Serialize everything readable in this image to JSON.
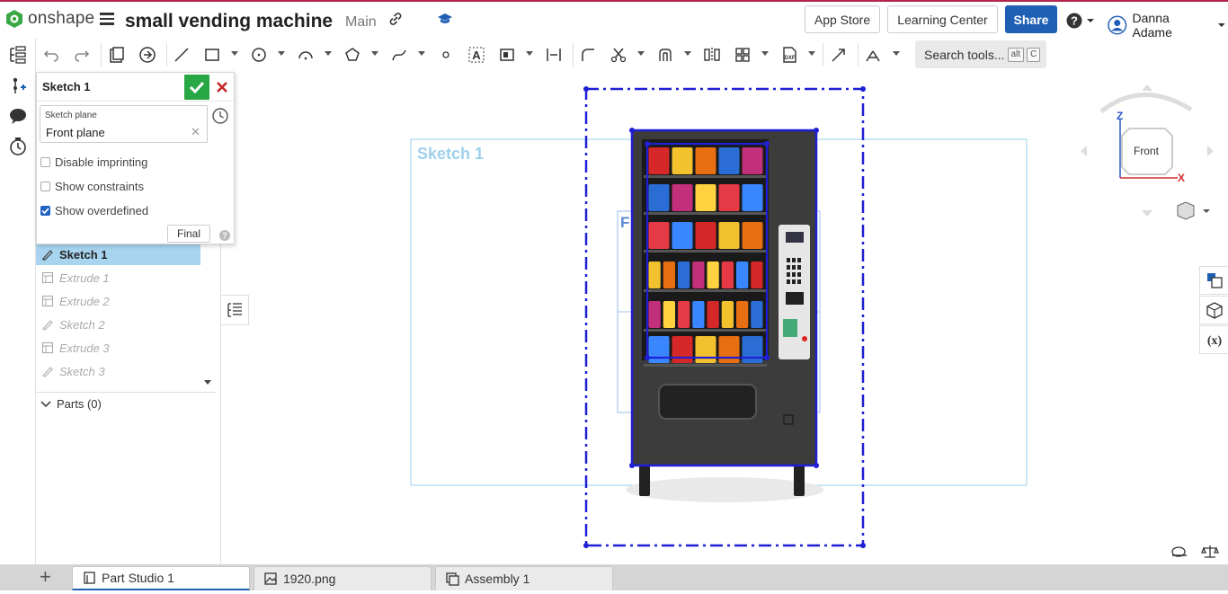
{
  "app": {
    "name": "onshape",
    "document_title": "small vending machine",
    "branch": "Main",
    "brand_color": "#b3254d",
    "accent_color": "#1f5fb4"
  },
  "header": {
    "app_store": "App Store",
    "learning_center": "Learning Center",
    "share": "Share",
    "help_icon": "question-circle-icon",
    "user_name": "Danna Adame"
  },
  "toolbar": {
    "search_label": "Search tools...",
    "search_key1": "alt",
    "search_key2": "C",
    "icons": [
      "undo-icon",
      "redo-icon",
      "new-sketch-icon",
      "extrude-icon",
      "line-icon",
      "rectangle-icon",
      "circle-icon",
      "arc-icon",
      "polygon-icon",
      "spline-icon",
      "point-icon",
      "text-icon",
      "construction-icon",
      "dimension-icon",
      "fillet-icon",
      "trim-icon",
      "offset-icon",
      "mirror-icon",
      "pattern-icon",
      "dxf-icon",
      "use-icon",
      "constraint-icon"
    ]
  },
  "sketch_dialog": {
    "title": "Sketch 1",
    "plane_label": "Sketch plane",
    "plane_value": "Front plane",
    "options": [
      {
        "label": "Disable imprinting",
        "checked": false
      },
      {
        "label": "Show constraints",
        "checked": false
      },
      {
        "label": "Show overdefined",
        "checked": true
      }
    ],
    "final_label": "Final"
  },
  "feature_list": {
    "items": [
      {
        "label": "Sketch 1",
        "selected": true,
        "icon": "sketch-icon"
      },
      {
        "label": "Extrude 1",
        "selected": false,
        "icon": "extrude-icon"
      },
      {
        "label": "Extrude 2",
        "selected": false,
        "icon": "extrude-icon"
      },
      {
        "label": "Sketch 2",
        "selected": false,
        "icon": "sketch-icon"
      },
      {
        "label": "Extrude 3",
        "selected": false,
        "icon": "extrude-icon"
      },
      {
        "label": "Sketch 3",
        "selected": false,
        "icon": "sketch-icon"
      }
    ],
    "parts_label": "Parts (0)"
  },
  "canvas": {
    "sketch_label": "Sketch 1",
    "partial_label": "F",
    "view_cube_face": "Front",
    "axis_z": "Z",
    "axis_x": "X"
  },
  "bottom_tabs": [
    {
      "label": "Part Studio 1",
      "active": true,
      "icon": "part-studio-icon"
    },
    {
      "label": "1920.png",
      "active": false,
      "icon": "image-icon"
    },
    {
      "label": "Assembly 1",
      "active": false,
      "icon": "assembly-icon"
    }
  ]
}
